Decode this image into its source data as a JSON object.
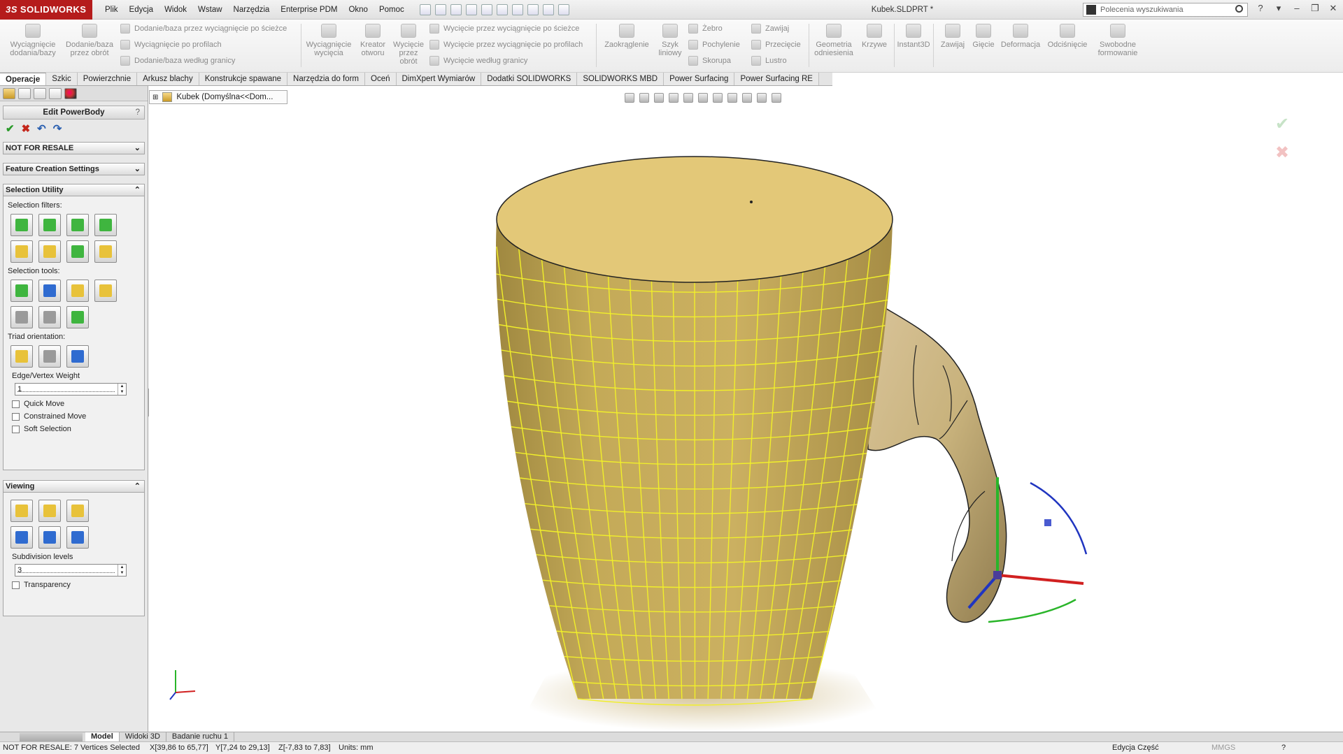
{
  "app": {
    "logo_text": "SOLIDWORKS",
    "logo_prefix": "3S",
    "document_title": "Kubek.SLDPRT *"
  },
  "menu": [
    "Plik",
    "Edycja",
    "Widok",
    "Wstaw",
    "Narzędzia",
    "Enterprise PDM",
    "Okno",
    "Pomoc"
  ],
  "search": {
    "placeholder": "Polecenia wyszukiwania"
  },
  "ribbon": {
    "extrude_boss": "Wyciągnięcie dodania/bazy",
    "revolve_boss": "Dodanie/baza przez obrót",
    "swept_boss": "Dodanie/baza przez wyciągnięcie po ścieżce",
    "lofted_boss": "Wyciągnięcie po profilach",
    "boundary_boss": "Dodanie/baza według granicy",
    "extruded_cut": "Wyciągnięcie wycięcia",
    "hole_wizard": "Kreator otworu",
    "revolved_cut": "Wycięcie przez obrót",
    "swept_cut": "Wycięcie przez wyciągnięcie po ścieżce",
    "lofted_cut": "Wycięcie przez wyciągnięcie po profilach",
    "boundary_cut": "Wycięcie według granicy",
    "fillet": "Zaokrąglenie",
    "linear_pattern": "Szyk liniowy",
    "rib": "Żebro",
    "draft": "Pochylenie",
    "shell": "Skorupa",
    "wrap": "Zawijaj",
    "intersect": "Przecięcie",
    "mirror": "Lustro",
    "reference_geometry": "Geometria odniesienia",
    "curves": "Krzywe",
    "instant3d": "Instant3D",
    "wrap2": "Zawijaj",
    "flex": "Gięcie",
    "deform": "Deformacja",
    "indent": "Odciśnięcie",
    "freeform": "Swobodne formowanie"
  },
  "tabs": [
    "Operacje",
    "Szkic",
    "Powierzchnie",
    "Arkusz blachy",
    "Konstrukcje spawane",
    "Narzędzia do form",
    "Oceń",
    "DimXpert Wymiarów",
    "Dodatki SOLIDWORKS",
    "SOLIDWORKS MBD",
    "Power Surfacing",
    "Power Surfacing RE"
  ],
  "tree_flyout": "Kubek  (Domyślna<<Dom...",
  "property_manager": {
    "title": "Edit PowerBody",
    "help": "?",
    "actions": {
      "ok": "✔",
      "cancel": "✖",
      "undo": "↶",
      "redo": "↷"
    },
    "groups": {
      "not_for_resale": "NOT FOR RESALE",
      "feature_creation": "Feature Creation Settings",
      "selection_utility": "Selection Utility",
      "viewing": "Viewing"
    },
    "selection_filters_label": "Selection filters:",
    "selection_tools_label": "Selection tools:",
    "triad_orientation_label": "Triad orientation:",
    "edge_vertex_weight_label": "Edge/Vertex Weight",
    "edge_vertex_weight_value": "1",
    "quick_move": "Quick Move",
    "constrained_move": "Constrained Move",
    "soft_selection": "Soft Selection",
    "subdivision_levels_label": "Subdivision levels",
    "subdivision_levels_value": "3",
    "transparency": "Transparency"
  },
  "bottom_tabs": [
    "Model",
    "Widoki 3D",
    "Badanie ruchu 1"
  ],
  "status": {
    "message": "NOT FOR RESALE: 7 Vertices Selected",
    "x": "X[39,86 to 65,77]",
    "y": "Y[7,24 to 29,13]",
    "z": "Z[-7,83 to 7,83]",
    "units": "Units: mm",
    "mode": "Edycja Część",
    "unit_system": "MMGS"
  },
  "colors": {
    "mug_fill": "#c7ac5a",
    "mug_top": "#e3c878",
    "mesh": "#f1ef2a",
    "brand_red": "#b51c1c"
  }
}
